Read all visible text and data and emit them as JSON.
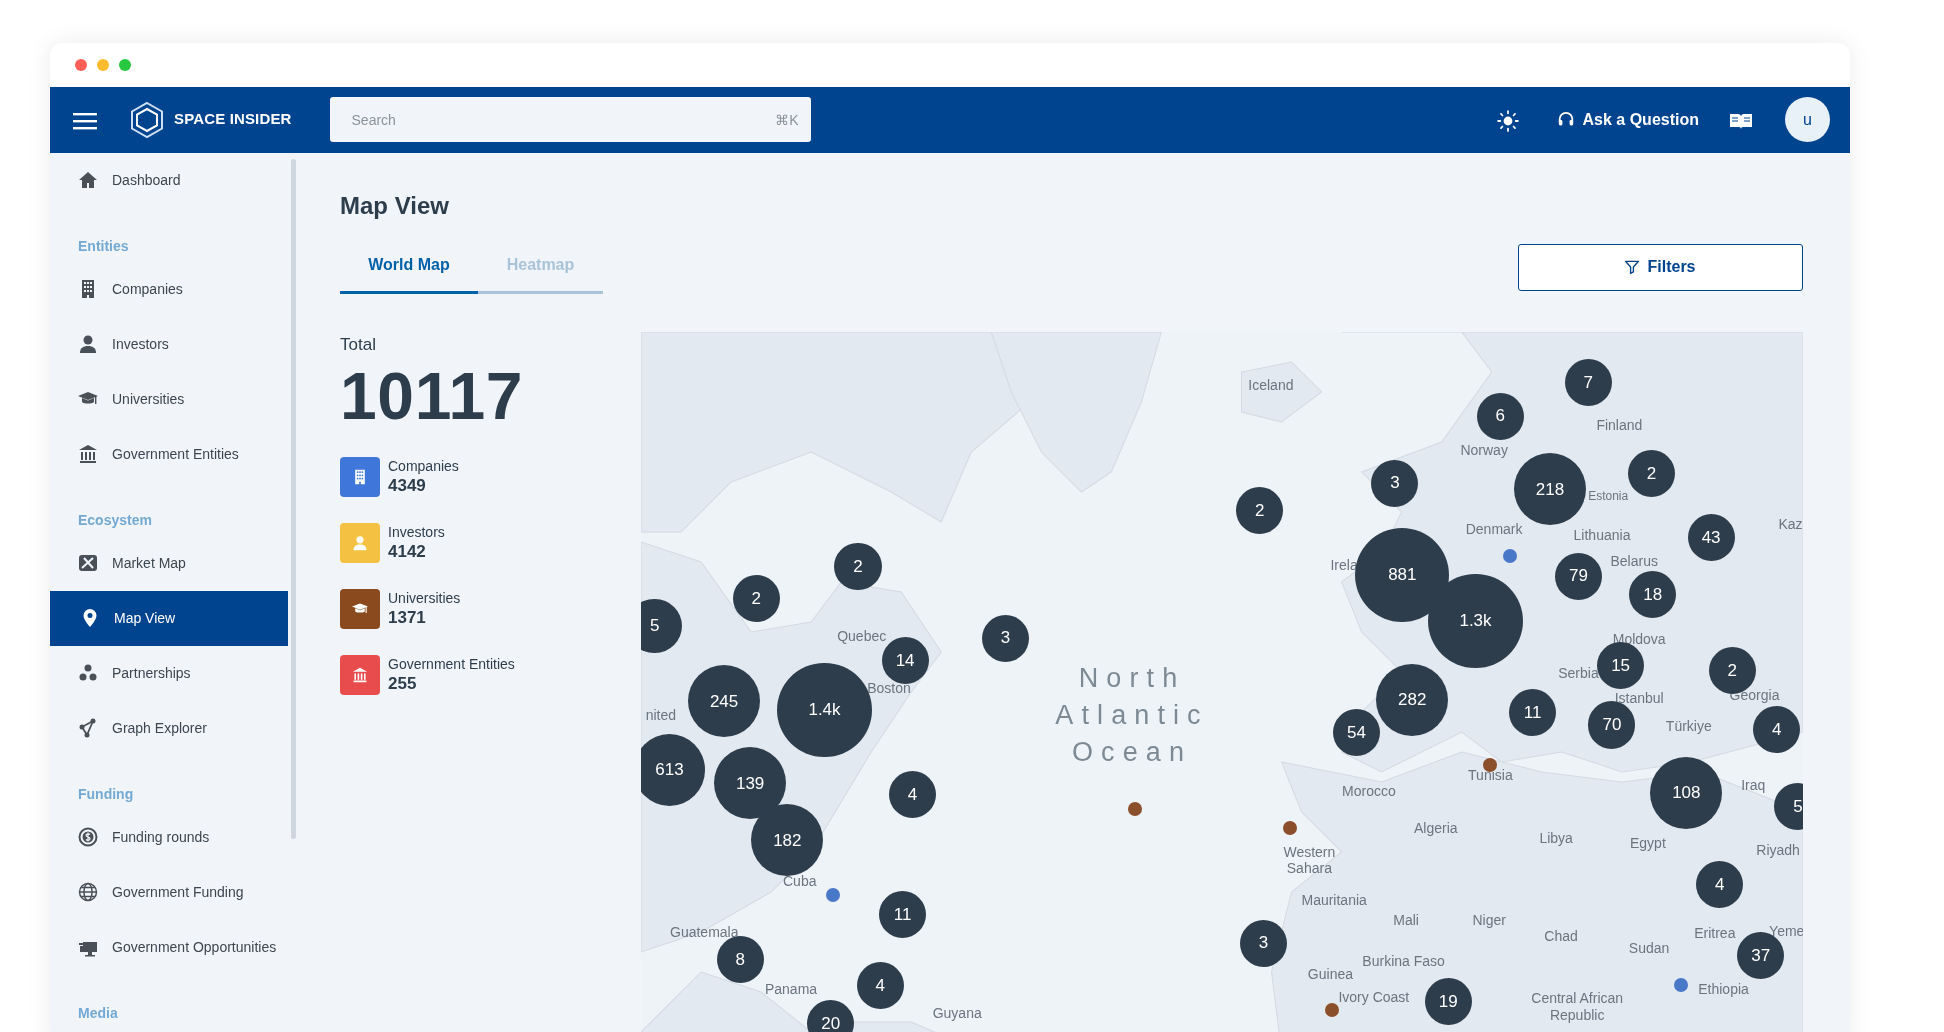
{
  "header": {
    "brand": "SPACE INSIDER",
    "search": {
      "placeholder": "Search",
      "shortcut": "⌘K"
    },
    "ask_button": "Ask a Question",
    "avatar": "u"
  },
  "sidebar": {
    "groups": [
      {
        "items": [
          {
            "label": "Dashboard",
            "selected": false
          }
        ]
      },
      {
        "heading": "Entities",
        "items": [
          {
            "label": "Companies",
            "selected": false
          },
          {
            "label": "Investors",
            "selected": false
          },
          {
            "label": "Universities",
            "selected": false
          },
          {
            "label": "Government Entities",
            "selected": false
          }
        ]
      },
      {
        "heading": "Ecosystem",
        "items": [
          {
            "label": "Market Map",
            "selected": false
          },
          {
            "label": "Map View",
            "selected": true
          },
          {
            "label": "Partnerships",
            "selected": false
          },
          {
            "label": "Graph Explorer",
            "selected": false
          }
        ]
      },
      {
        "heading": "Funding",
        "items": [
          {
            "label": "Funding rounds",
            "selected": false
          },
          {
            "label": "Government Funding",
            "selected": false
          },
          {
            "label": "Government Opportunities",
            "selected": false
          }
        ]
      },
      {
        "heading": "Media"
      }
    ]
  },
  "page": {
    "title": "Map View",
    "tabs": [
      {
        "label": "World Map",
        "selected": true
      },
      {
        "label": "Heatmap",
        "selected": false
      }
    ],
    "filters_button": "Filters"
  },
  "summary": {
    "label": "Total",
    "total": "10117",
    "stats": [
      {
        "label": "Companies",
        "value": "4349",
        "color": "#3f76d9"
      },
      {
        "label": "Investors",
        "value": "4142",
        "color": "#f4c142"
      },
      {
        "label": "Universities",
        "value": "1371",
        "color": "#8b4a1e"
      },
      {
        "label": "Government Entities",
        "value": "255",
        "color": "#e84c4c"
      }
    ]
  },
  "map": {
    "ocean_label": [
      "North",
      "Atlantic",
      "Ocean"
    ],
    "places": [
      "Iceland",
      "Norway",
      "Finland",
      "Denmark",
      "Estonia",
      "Lithuania",
      "Belarus",
      "Irela",
      "Kaz",
      "Moldova",
      "Serbia",
      "Istanbul",
      "Georgia",
      "Türkiye",
      "Iraq",
      "Riyadh",
      "Morocco",
      "Tunisia",
      "Algeria",
      "Libya",
      "Egypt",
      "Western Sahara",
      "Mauritania",
      "Mali",
      "Niger",
      "Chad",
      "Sudan",
      "Eritrea",
      "Yeme",
      "Ethiopia",
      "Burkina Faso",
      "Guinea",
      "Ivory Coast",
      "Central African Republic",
      "Quebec",
      "Boston",
      "nited",
      "Cuba",
      "Guatemala",
      "Panama",
      "Guyana"
    ],
    "clusters": [
      {
        "label": "5"
      },
      {
        "label": "2"
      },
      {
        "label": "2"
      },
      {
        "label": "3"
      },
      {
        "label": "14"
      },
      {
        "label": "245"
      },
      {
        "label": "1.4k"
      },
      {
        "label": "613"
      },
      {
        "label": "139"
      },
      {
        "label": "182"
      },
      {
        "label": "4"
      },
      {
        "label": "11"
      },
      {
        "label": "8"
      },
      {
        "label": "4"
      },
      {
        "label": "20"
      },
      {
        "label": "2"
      },
      {
        "label": "3"
      },
      {
        "label": "6"
      },
      {
        "label": "7"
      },
      {
        "label": "218"
      },
      {
        "label": "2"
      },
      {
        "label": "43"
      },
      {
        "label": "881"
      },
      {
        "label": "1.3k"
      },
      {
        "label": "79"
      },
      {
        "label": "18"
      },
      {
        "label": "15"
      },
      {
        "label": "2"
      },
      {
        "label": "282"
      },
      {
        "label": "54"
      },
      {
        "label": "11"
      },
      {
        "label": "70"
      },
      {
        "label": "4"
      },
      {
        "label": "108"
      },
      {
        "label": "5"
      },
      {
        "label": "4"
      },
      {
        "label": "37"
      },
      {
        "label": "3"
      },
      {
        "label": "19"
      }
    ],
    "markers": [
      {
        "color": "#4a78c9"
      },
      {
        "color": "#4a78c9"
      },
      {
        "color": "#4a78c9"
      },
      {
        "color": "#8b4f2b"
      },
      {
        "color": "#8b4f2b"
      },
      {
        "color": "#8b4f2b"
      },
      {
        "color": "#8b4f2b"
      }
    ]
  }
}
